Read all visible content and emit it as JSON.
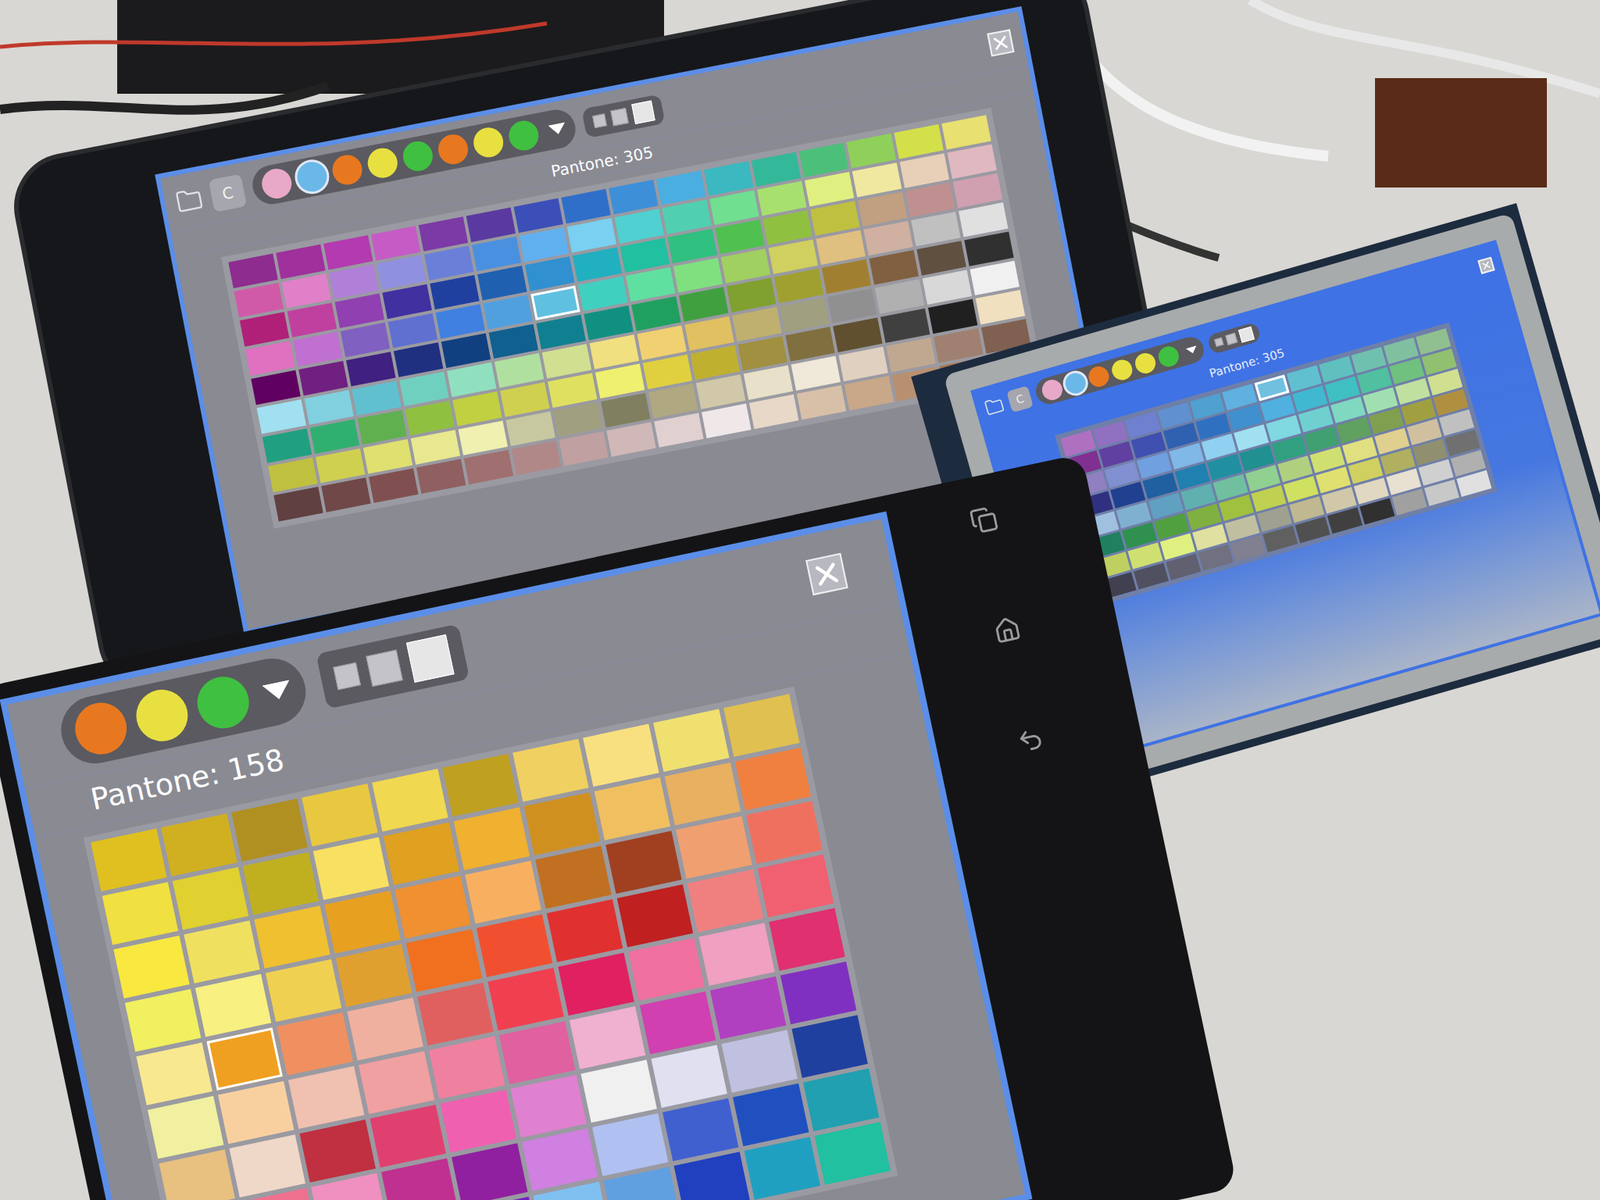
{
  "devices": [
    {
      "kind": "phone",
      "c_button": "C",
      "label": "Pantone: 305",
      "recent_colors": [
        {
          "color": "#e8a8c8",
          "selected": false
        },
        {
          "color": "#6ab8e8",
          "selected": true
        },
        {
          "color": "#e87820",
          "selected": false
        },
        {
          "color": "#e8e040",
          "selected": false
        },
        {
          "color": "#40c040",
          "selected": false
        },
        {
          "color": "#e87820",
          "selected": false
        },
        {
          "color": "#e8e040",
          "selected": false
        },
        {
          "color": "#40c040",
          "selected": false
        }
      ],
      "sizes": [
        {
          "selected": false
        },
        {
          "selected": false
        },
        {
          "selected": true
        }
      ],
      "selected_swatch": "#60c0e0",
      "swatches": [
        [
          "#8e2c8f",
          "#a0309c",
          "#b33ab0",
          "#c65bc6",
          "#7c3aa6",
          "#5a3aa0",
          "#3c4fb8",
          "#2f6fc9",
          "#3d8fd8",
          "#4aaee0",
          "#3bb8c0",
          "#34b89a",
          "#4cc07a",
          "#8fd05a",
          "#d4e04a",
          "#e8e070"
        ],
        [
          "#d05aa8",
          "#e080c8",
          "#b080d8",
          "#9090e0",
          "#6a80d8",
          "#4a90e0",
          "#60b0f0",
          "#7ad0f0",
          "#50d0d0",
          "#50d0b0",
          "#70e090",
          "#a8e070",
          "#e0f080",
          "#f0e8a0",
          "#e8d0b8",
          "#e0b8c0"
        ],
        [
          "#b02078",
          "#c040a0",
          "#9040b0",
          "#4030a0",
          "#2040a0",
          "#2060b0",
          "#3090d0",
          "#20b0c0",
          "#20c0a0",
          "#30c080",
          "#50c050",
          "#90c040",
          "#c0c040",
          "#c0a080",
          "#c09090",
          "#d0a0b0"
        ],
        [
          "#e070c0",
          "#c070d0",
          "#8060c0",
          "#6070d0",
          "#4080e0",
          "#50a0e0",
          "#60c0e0",
          "#40d0c0",
          "#60e0a0",
          "#80e080",
          "#a0d060",
          "#d0d060",
          "#e0c080",
          "#d0b0a0",
          "#c0c0c0",
          "#e0e0e0"
        ],
        [
          "#600060",
          "#702080",
          "#402080",
          "#203080",
          "#104080",
          "#106090",
          "#108090",
          "#109080",
          "#20a060",
          "#40a040",
          "#80a030",
          "#a0a030",
          "#a08030",
          "#806040",
          "#605040",
          "#303030"
        ],
        [
          "#a0e0f0",
          "#80d0e0",
          "#60c0d0",
          "#70d0c0",
          "#90e0c0",
          "#b0e0a0",
          "#d0e090",
          "#f0e080",
          "#f0d070",
          "#e0c060",
          "#c0b070",
          "#a0a080",
          "#909090",
          "#b0b0b0",
          "#d8d8d8",
          "#f0f0f0"
        ],
        [
          "#20a080",
          "#30b070",
          "#60b050",
          "#90c040",
          "#c0d040",
          "#d0d050",
          "#e0e060",
          "#f0f070",
          "#e0d040",
          "#c0b030",
          "#a09040",
          "#807040",
          "#605030",
          "#404040",
          "#202020",
          "#f0e0c0"
        ],
        [
          "#c0c040",
          "#d0d050",
          "#e0e070",
          "#e8e890",
          "#f0f0b0",
          "#c8c8a0",
          "#a0a080",
          "#808060",
          "#b0a880",
          "#d0c8a8",
          "#e8e0c8",
          "#f0e8d8",
          "#e0d0c0",
          "#c0a890",
          "#a08070",
          "#806050"
        ],
        [
          "#604040",
          "#704848",
          "#805050",
          "#906060",
          "#a07070",
          "#b08888",
          "#c0a0a0",
          "#d0b8b8",
          "#e0d0d0",
          "#f0e8e8",
          "#e8d8c8",
          "#d8c0a8",
          "#c8a888",
          "#b89070",
          "#a87850",
          "#c04030"
        ]
      ]
    },
    {
      "kind": "lcd",
      "c_button": "C",
      "label": "Pantone: 305",
      "recent_colors": [
        {
          "color": "#e8a8c8",
          "selected": false
        },
        {
          "color": "#6ab8e8",
          "selected": true
        },
        {
          "color": "#e87820",
          "selected": false
        },
        {
          "color": "#e8e040",
          "selected": false
        },
        {
          "color": "#e8e040",
          "selected": false
        },
        {
          "color": "#40c040",
          "selected": false
        }
      ],
      "sizes": [
        {
          "selected": false
        },
        {
          "selected": false
        },
        {
          "selected": true
        }
      ],
      "selected_swatch": "#70c0e0",
      "swatches": [
        [
          "#b070c0",
          "#9070c0",
          "#7080d0",
          "#6090d0",
          "#50a0d0",
          "#60b0e0",
          "#70c0e0",
          "#60c0d0",
          "#60c0c0",
          "#70c0b0",
          "#80c0a0",
          "#90c090"
        ],
        [
          "#803090",
          "#6040a0",
          "#4050b0",
          "#3060b0",
          "#3070c0",
          "#4090d0",
          "#50b0e0",
          "#40b8d0",
          "#40c0c0",
          "#50c0a0",
          "#70c080",
          "#90c070"
        ],
        [
          "#9080c0",
          "#8090d0",
          "#70a0e0",
          "#80b8e8",
          "#90d0f0",
          "#a0e0f0",
          "#80d8e0",
          "#70d0d0",
          "#80d8c0",
          "#a0e0b0",
          "#c0e0a0",
          "#d0e090"
        ],
        [
          "#303080",
          "#204090",
          "#2060a0",
          "#2080b0",
          "#2090a0",
          "#209090",
          "#30a080",
          "#40a070",
          "#60a060",
          "#80a050",
          "#a0a040",
          "#b09040"
        ],
        [
          "#a0c0e0",
          "#80b0d0",
          "#60a0c0",
          "#60b0b0",
          "#70c0a0",
          "#90d090",
          "#b0d080",
          "#d0e070",
          "#e0e080",
          "#e0d090",
          "#d0c0a0",
          "#c0c0c0"
        ],
        [
          "#208060",
          "#309050",
          "#50a040",
          "#80b040",
          "#a0c040",
          "#c0d050",
          "#d0e060",
          "#e0e070",
          "#d0d060",
          "#b0b060",
          "#909070",
          "#707070"
        ],
        [
          "#c0d060",
          "#d0e070",
          "#e0f080",
          "#e0e0a0",
          "#c0c0a0",
          "#a0a090",
          "#c0b890",
          "#d0c8a8",
          "#e0d8c0",
          "#e8e0d0",
          "#d0d0d0",
          "#b0b0b0"
        ],
        [
          "#404050",
          "#505060",
          "#606070",
          "#707080",
          "#808090",
          "#606060",
          "#505050",
          "#404040",
          "#303030",
          "#a0a0a0",
          "#c8c8c8",
          "#e0e0e0"
        ]
      ]
    },
    {
      "kind": "tablet",
      "label": "Pantone: 158",
      "recent_colors": [
        {
          "color": "#e87820",
          "selected": false
        },
        {
          "color": "#e8e040",
          "selected": false
        },
        {
          "color": "#40c040",
          "selected": false
        }
      ],
      "sizes": [
        {
          "selected": false
        },
        {
          "selected": false
        },
        {
          "selected": true
        }
      ],
      "selected_swatch": "#f0a020",
      "swatches": [
        [
          "#e0c020",
          "#d0b020",
          "#b09020",
          "#e8c840",
          "#f0d850",
          "#c0a020",
          "#f0d060",
          "#f8e080",
          "#f0e070",
          "#e0c050"
        ],
        [
          "#f0e040",
          "#e0d030",
          "#c0b020",
          "#f8e060",
          "#e0a020",
          "#f0b030",
          "#d09020",
          "#f0c060",
          "#e8b060",
          "#f08040"
        ],
        [
          "#f8e840",
          "#f0e060",
          "#f0c030",
          "#e8a020",
          "#f09030",
          "#f8b060",
          "#c07020",
          "#a04020",
          "#f0a070",
          "#f07060"
        ],
        [
          "#f0f060",
          "#f8f080",
          "#f0d050",
          "#e0a030",
          "#f07020",
          "#f05030",
          "#e03030",
          "#c02020",
          "#f08080",
          "#f06070"
        ],
        [
          "#f8e890",
          "#f0a020",
          "#f09060",
          "#f0b0a0",
          "#e06060",
          "#f04050",
          "#e02060",
          "#f070a0",
          "#f0a0c0",
          "#e03070"
        ],
        [
          "#f0f0a0",
          "#f8d0a0",
          "#f0c0b0",
          "#f0a0a0",
          "#f080a0",
          "#e060a0",
          "#f0b0d0",
          "#d040b0",
          "#b040c0",
          "#8030c0"
        ],
        [
          "#e8c080",
          "#f0d8c8",
          "#c03040",
          "#e04070",
          "#f060b0",
          "#e080d0",
          "#f0f0f0",
          "#e0e0f0",
          "#c0c0e0",
          "#2040a0"
        ],
        [
          "#e03050",
          "#f07090",
          "#f090c0",
          "#c03090",
          "#9020a0",
          "#d080e0",
          "#b0c0f0",
          "#4060d0",
          "#2050c0",
          "#20a0b0"
        ],
        [
          "#f0a0b0",
          "#e060a0",
          "#a02080",
          "#c050d0",
          "#7020c0",
          "#80c0f0",
          "#60a0e0",
          "#2040c0",
          "#20a0c0",
          "#20c0a0"
        ]
      ]
    }
  ]
}
